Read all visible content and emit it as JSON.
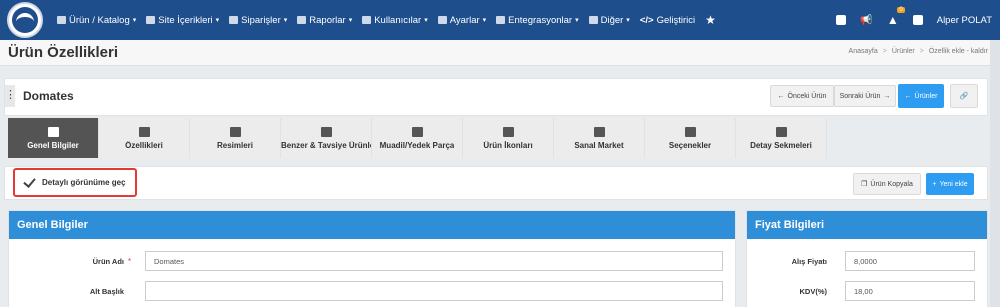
{
  "nav": {
    "items": [
      {
        "label": "Ürün / Katalog",
        "icon": "list-icon",
        "caret": true
      },
      {
        "label": "Site İçerikleri",
        "icon": "layers-icon",
        "caret": true
      },
      {
        "label": "Siparişler",
        "icon": "truck-icon",
        "caret": true
      },
      {
        "label": "Raporlar",
        "icon": "chart-icon",
        "caret": true
      },
      {
        "label": "Kullanıcılar",
        "icon": "users-icon",
        "caret": true
      },
      {
        "label": "Ayarlar",
        "icon": "cogs-icon",
        "caret": true
      },
      {
        "label": "Entegrasyonlar",
        "icon": "sitemap-icon",
        "caret": true
      },
      {
        "label": "Diğer",
        "icon": "grid-icon",
        "caret": true
      },
      {
        "label": "Geliştirici",
        "icon": "code-icon",
        "caret": false
      }
    ],
    "notification_badge": "0",
    "user": "Alper POLAT"
  },
  "page": {
    "title": "Ürün Özellikleri",
    "breadcrumb": [
      "Anasayfa",
      "Ürünler",
      "Özellik ekle - kaldır"
    ]
  },
  "product": {
    "name": "Domates",
    "prev_label": "Önceki Ürün",
    "next_label": "Sonraki Ürün",
    "products_label": "Ürünler"
  },
  "tabs": [
    {
      "label": "Genel Bilgiler",
      "icon": "cogs-icon",
      "active": true
    },
    {
      "label": "Özellikleri",
      "icon": "copy-icon",
      "active": false
    },
    {
      "label": "Resimleri",
      "icon": "images-icon",
      "active": false
    },
    {
      "label": "Benzer & Tavsiye Ürünle",
      "icon": "balance-icon",
      "active": false
    },
    {
      "label": "Muadil/Yedek Parça",
      "icon": "checkbox-icon",
      "active": false
    },
    {
      "label": "Ürün İkonları",
      "icon": "file-image-icon",
      "active": false
    },
    {
      "label": "Sanal Market",
      "icon": "cart-icon",
      "active": false
    },
    {
      "label": "Seçenekler",
      "icon": "list-ul-icon",
      "active": false
    },
    {
      "label": "Detay Sekmeleri",
      "icon": "sitemap-icon",
      "active": false
    }
  ],
  "detail": {
    "toggle_label": "Detaylı görünüme geç",
    "copy_label": "Ürün Kopyala",
    "new_label": "Yeni ekle"
  },
  "general": {
    "title": "Genel Bilgiler",
    "name_label": "Ürün Adı",
    "name_value": "Domates",
    "subtitle_label": "Alt Başlık",
    "subtitle_value": ""
  },
  "price": {
    "title": "Fiyat Bilgileri",
    "purchase_label": "Alış Fiyatı",
    "purchase_value": "8,0000",
    "vat_label": "KDV(%)",
    "vat_value": "18,00"
  }
}
